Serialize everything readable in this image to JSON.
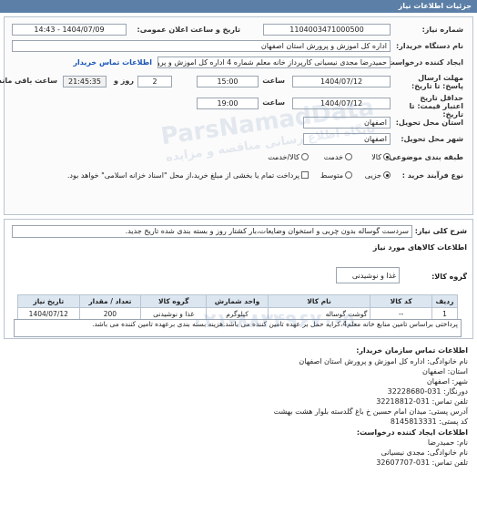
{
  "header": {
    "title": "جزئیات اطلاعات نیاز"
  },
  "form": {
    "need_number_label": "شماره نیاز:",
    "need_number": "1104003471000500",
    "announce_label": "تاریخ و ساعت اعلان عمومی:",
    "announce_value": "1404/07/09 - 14:43",
    "buyer_label": "نام دستگاه خریدار:",
    "buyer_value": "اداره کل اموزش و پرورش استان اصفهان",
    "creator_label": "ایجاد کننده درخواست:",
    "creator_value": "حمیدرضا مجدی نیسیانی کارپرداز خانه معلم شماره 4 اداره کل اموزش و پرورش",
    "contact_link": "اطلاعات تماس خریدار",
    "deadline_label": "مهلت ارسال پاسخ: تا تاریخ:",
    "deadline_date": "1404/07/12",
    "time_label": "ساعت",
    "deadline_time": "15:00",
    "days_value": "2",
    "days_label": "روز و",
    "remaining_time": "21:45:35",
    "remaining_label": "ساعت باقی مانده",
    "validity_label": "حداقل تاریخ اعتبار قیمت: تا تاریخ:",
    "validity_date": "1404/07/12",
    "validity_time": "19:00",
    "province_label": "استان محل تحویل:",
    "province_value": "اصفهان",
    "city_label": "شهر محل تحویل:",
    "city_value": "اصفهان",
    "category_label": "طبقه بندی موضوعی:",
    "category_options": [
      "کالا",
      "خدمت",
      "کالا/خدمت"
    ],
    "category_selected": 0,
    "process_label": "نوع فرآیند خرید :",
    "process_options": [
      "جزیی",
      "متوسط"
    ],
    "process_selected": 0,
    "payment_note": "پرداخت تمام یا بخشی از مبلغ خرید،از محل \"اسناد خزانه اسلامی\" خواهد بود."
  },
  "description": {
    "label": "شرح کلی نیاز:",
    "value": "سردست گوساله بدون چربی و استخوان وضایعات،بار کشتار روز و بسته بندی شده تاریخ جدید.",
    "goods_title": "اطلاعات کالاهای مورد نیاز",
    "goods_group_label": "گروه کالا:",
    "goods_group_value": "غذا و نوشیدنی"
  },
  "table": {
    "headers": [
      "ردیف",
      "کد کالا",
      "نام کالا",
      "واحد شمارش",
      "گروه کالا",
      "تعداد / مقدار",
      "تاریخ نیاز"
    ],
    "rows": [
      [
        "1",
        "--",
        "گوشت گوساله",
        "کیلوگرم",
        "غذا و نوشیدنی",
        "200",
        "1404/07/12"
      ]
    ]
  },
  "notes": "پرداختی براساس تامین منابع خانه معلم4،کرایه حمل بر عهده تامین کننده می باشد.هزینه بسته بندی برعهده تامین کننده می باشد.",
  "contact": {
    "title": "اطلاعات تماس سازمان خریدار:",
    "lines": [
      "نام خانوادگی: اداره کل اموزش و پرورش استان اصفهان",
      "استان: اصفهان",
      "شهر: اصفهان",
      "دورنگار: 031-32228680",
      "تلفن تماس: 031-32218812",
      "آدرس پستی: میدان امام حسین خ باغ گلدسته بلوار هشت بهشت",
      "کد پستی: 8145813331",
      "اطلاعات ایجاد کننده درخواست:",
      "نام: حمیدرضا",
      "نام خانوادگی: مجدی نیسیانی",
      "تلفن تماس: 031-32607707"
    ]
  },
  "watermark": {
    "phone": "۰۲۱-۸۸۳۴۹۶۷۰-۵",
    "brand": "ParsNamadData",
    "site": "پایگاه اطلاع رسانی مناقصه و مزایده"
  }
}
